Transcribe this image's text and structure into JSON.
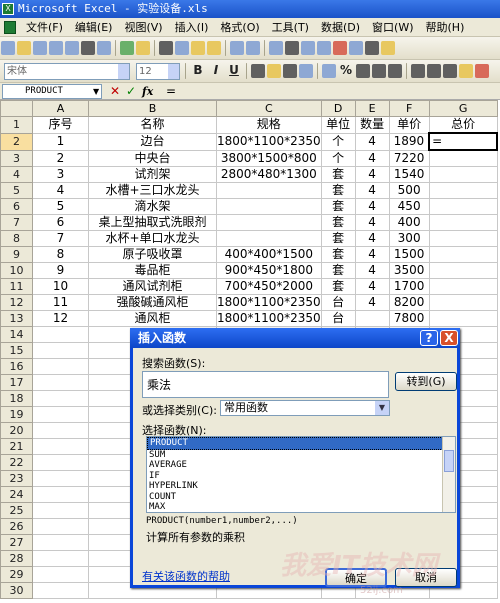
{
  "window": {
    "title": "Microsoft Excel - 实验设备.xls"
  },
  "menu": [
    "文件(F)",
    "编辑(E)",
    "视图(V)",
    "插入(I)",
    "格式(O)",
    "工具(T)",
    "数据(D)",
    "窗口(W)",
    "帮助(H)"
  ],
  "format_bar": {
    "font": "宋体",
    "size": "12",
    "bold": "B",
    "italic": "I",
    "underline": "U",
    "percent": "%"
  },
  "formula_bar": {
    "name_box": "PRODUCT",
    "fx": "fx",
    "content": "="
  },
  "columns": [
    "A",
    "B",
    "C",
    "D",
    "E",
    "F",
    "G"
  ],
  "rows": [
    [
      "1",
      "序号",
      "名称",
      "规格",
      "单位",
      "数量",
      "单价",
      "总价"
    ],
    [
      "2",
      "1",
      "边台",
      "1800*1100*2350",
      "个",
      "4",
      "1890",
      "="
    ],
    [
      "3",
      "2",
      "中央台",
      "3800*1500*800",
      "个",
      "4",
      "7220",
      ""
    ],
    [
      "4",
      "3",
      "试剂架",
      "2800*480*1300",
      "套",
      "4",
      "1540",
      ""
    ],
    [
      "5",
      "4",
      "水槽+三口水龙头",
      "",
      "套",
      "4",
      "500",
      ""
    ],
    [
      "6",
      "5",
      "滴水架",
      "",
      "套",
      "4",
      "450",
      ""
    ],
    [
      "7",
      "6",
      "桌上型抽取式洗眼剂",
      "",
      "套",
      "4",
      "400",
      ""
    ],
    [
      "8",
      "7",
      "水杯+单口水龙头",
      "",
      "套",
      "4",
      "300",
      ""
    ],
    [
      "9",
      "8",
      "原子吸收罩",
      "400*400*1500",
      "套",
      "4",
      "1500",
      ""
    ],
    [
      "10",
      "9",
      "毒品柜",
      "900*450*1800",
      "套",
      "4",
      "3500",
      ""
    ],
    [
      "11",
      "10",
      "通风试剂柜",
      "700*450*2000",
      "套",
      "4",
      "1700",
      ""
    ],
    [
      "12",
      "11",
      "强酸碱通风柜",
      "1800*1100*2350",
      "台",
      "4",
      "8200",
      ""
    ],
    [
      "13",
      "12",
      "通风柜",
      "1800*1100*2350",
      "台",
      "",
      "7800",
      ""
    ],
    [
      "14",
      "",
      "",
      "",
      "",
      "",
      "",
      ""
    ],
    [
      "15",
      "",
      "",
      "",
      "",
      "",
      "",
      ""
    ],
    [
      "16",
      "",
      "",
      "",
      "",
      "",
      "",
      ""
    ],
    [
      "17",
      "",
      "",
      "",
      "",
      "",
      "",
      ""
    ],
    [
      "18",
      "",
      "",
      "",
      "",
      "",
      "",
      ""
    ],
    [
      "19",
      "",
      "",
      "",
      "",
      "",
      "",
      ""
    ],
    [
      "20",
      "",
      "",
      "",
      "",
      "",
      "",
      ""
    ],
    [
      "21",
      "",
      "",
      "",
      "",
      "",
      "",
      ""
    ],
    [
      "22",
      "",
      "",
      "",
      "",
      "",
      "",
      ""
    ],
    [
      "23",
      "",
      "",
      "",
      "",
      "",
      "",
      ""
    ],
    [
      "24",
      "",
      "",
      "",
      "",
      "",
      "",
      ""
    ],
    [
      "25",
      "",
      "",
      "",
      "",
      "",
      "",
      ""
    ],
    [
      "26",
      "",
      "",
      "",
      "",
      "",
      "",
      ""
    ],
    [
      "27",
      "",
      "",
      "",
      "",
      "",
      "",
      ""
    ],
    [
      "28",
      "",
      "",
      "",
      "",
      "",
      "",
      ""
    ],
    [
      "29",
      "",
      "",
      "",
      "",
      "",
      "",
      ""
    ],
    [
      "30",
      "",
      "",
      "",
      "",
      "",
      "",
      ""
    ]
  ],
  "dialog": {
    "title": "插入函数",
    "help_btn": "?",
    "close_btn": "X",
    "search_label": "搜索函数(S):",
    "search_value": "乘法",
    "goto_btn": "转到(G)",
    "category_label": "或选择类别(C):",
    "category_value": "常用函数",
    "select_label": "选择函数(N):",
    "functions": [
      "PRODUCT",
      "SUM",
      "AVERAGE",
      "IF",
      "HYPERLINK",
      "COUNT",
      "MAX"
    ],
    "signature": "PRODUCT(number1,number2,...)",
    "description": "计算所有参数的乘积",
    "help_link": "有关该函数的帮助",
    "ok_btn": "确定",
    "cancel_btn": "取消"
  },
  "watermark": {
    "text": "我爱IT技术网",
    "url": "52ij.com"
  }
}
